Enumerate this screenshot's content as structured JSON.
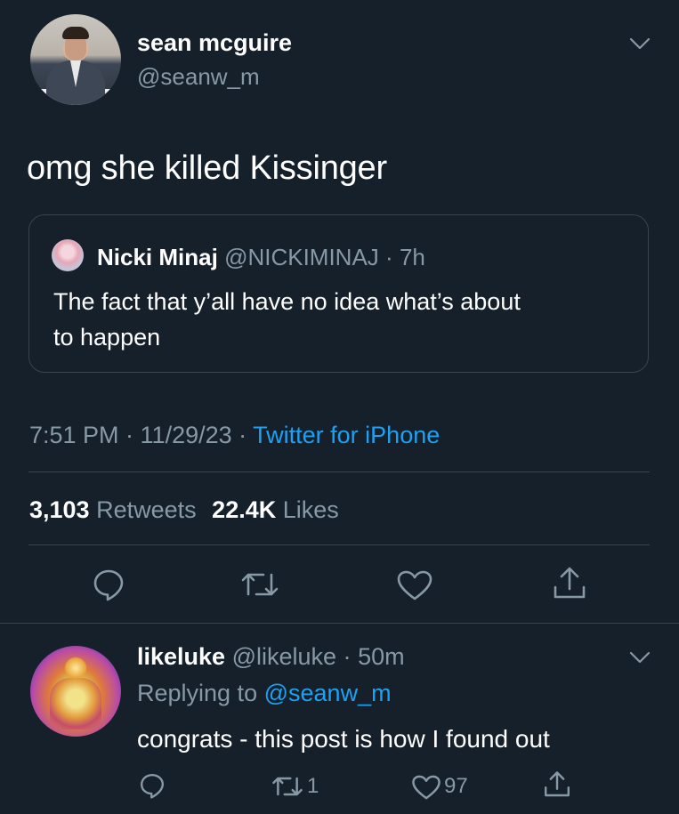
{
  "tweet": {
    "author_name": "sean mcguire",
    "author_handle": "@seanw_m",
    "text": "omg she killed Kissinger",
    "quoted": {
      "author_name": "Nicki Minaj",
      "author_handle": "@NICKIMINAJ",
      "separator": "·",
      "time_ago": "7h",
      "text_line1": "The fact that y’all have no idea what’s about",
      "text_line2": "to happen"
    },
    "timestamp": "7:51 PM · 11/29/23 ·",
    "source": "Twitter for iPhone",
    "retweet_count": "3,103",
    "retweet_label": "Retweets",
    "like_count": "22.4K",
    "like_label": "Likes"
  },
  "reply": {
    "author_name": "likeluke",
    "author_handle": "@likeluke",
    "separator": "·",
    "time_ago": "50m",
    "replying_label": "Replying to",
    "replying_to": "@seanw_m",
    "text": "congrats - this post is how I found out",
    "retweet_count": "1",
    "like_count": "97"
  },
  "icons": {
    "chevron": "chevron-down-icon",
    "reply": "reply-icon",
    "retweet": "retweet-icon",
    "like": "heart-icon",
    "share": "share-icon"
  },
  "colors": {
    "background": "#15202b",
    "text": "#ffffff",
    "muted": "#8899a6",
    "accent": "#1da1f2",
    "border": "#38444d"
  }
}
